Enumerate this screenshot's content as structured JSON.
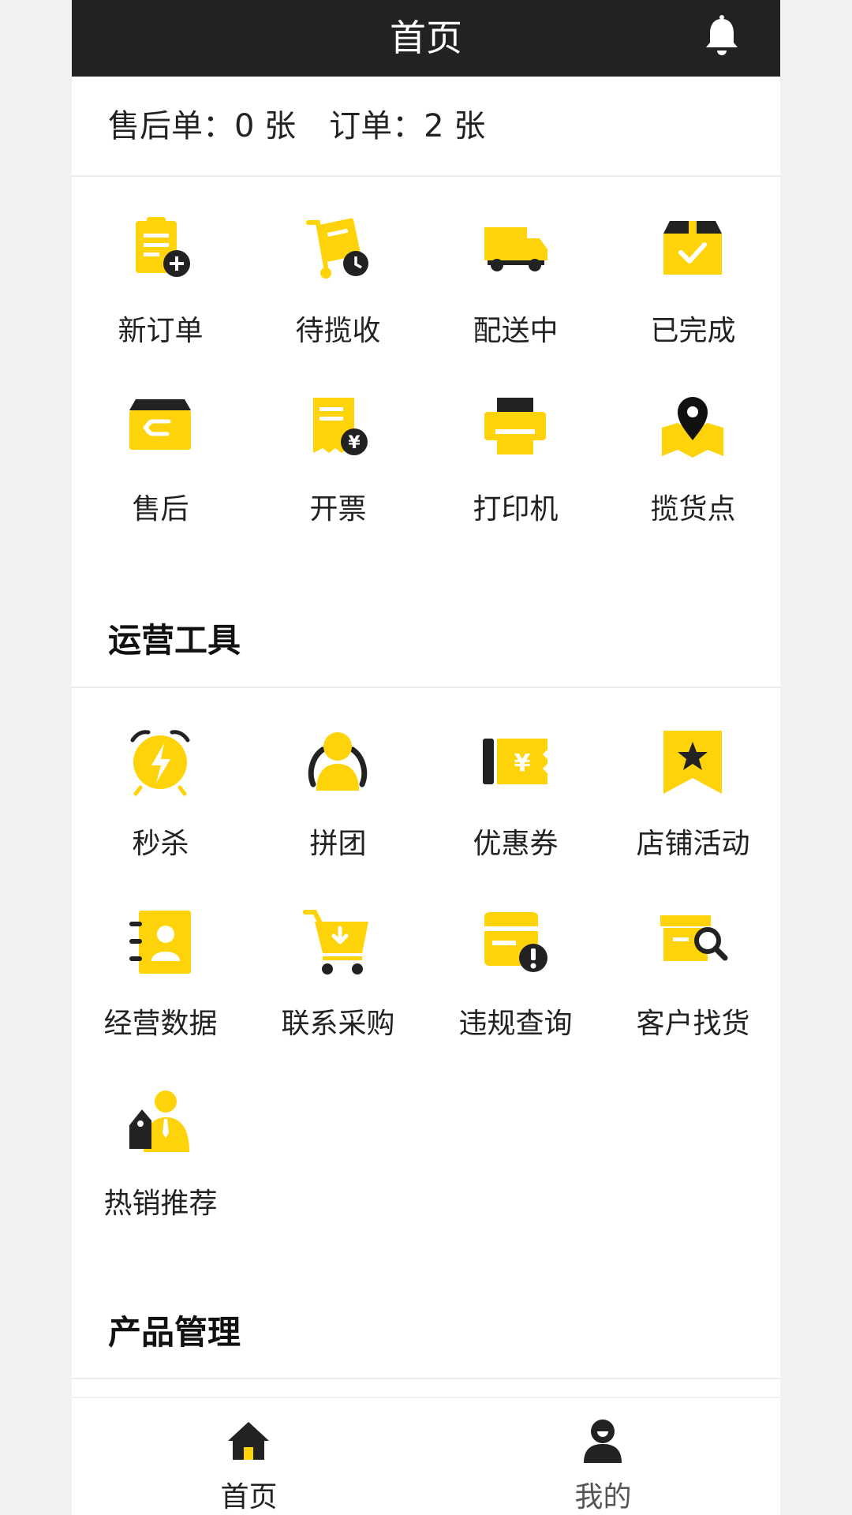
{
  "header": {
    "title": "首页",
    "bell_icon": "bell-icon"
  },
  "summary": {
    "after_sales_label": "售后单：",
    "after_sales_count": "0 张",
    "orders_label": "订单：",
    "orders_count": "2 张"
  },
  "order_grid": [
    {
      "label": "新订单",
      "icon": "new-order-icon"
    },
    {
      "label": "待揽收",
      "icon": "pending-pickup-icon"
    },
    {
      "label": "配送中",
      "icon": "delivery-truck-icon"
    },
    {
      "label": "已完成",
      "icon": "completed-box-icon"
    },
    {
      "label": "售后",
      "icon": "after-sales-box-icon"
    },
    {
      "label": "开票",
      "icon": "invoice-icon"
    },
    {
      "label": "打印机",
      "icon": "printer-icon"
    },
    {
      "label": "揽货点",
      "icon": "pickup-location-icon"
    }
  ],
  "operations": {
    "title": "运营工具",
    "items": [
      {
        "label": "秒杀",
        "icon": "flash-sale-clock-icon"
      },
      {
        "label": "拼团",
        "icon": "group-buy-icon"
      },
      {
        "label": "优惠券",
        "icon": "coupon-icon"
      },
      {
        "label": "店铺活动",
        "icon": "store-activity-icon"
      },
      {
        "label": "经营数据",
        "icon": "business-data-icon"
      },
      {
        "label": "联系采购",
        "icon": "purchase-cart-icon"
      },
      {
        "label": "违规查询",
        "icon": "violation-query-icon"
      },
      {
        "label": "客户找货",
        "icon": "customer-search-icon"
      },
      {
        "label": "热销推荐",
        "icon": "hot-sale-recommend-icon"
      }
    ]
  },
  "products": {
    "title": "产品管理"
  },
  "tabbar": {
    "items": [
      {
        "label": "首页",
        "icon": "home-icon",
        "active": true
      },
      {
        "label": "我的",
        "icon": "profile-icon",
        "active": false
      }
    ]
  },
  "colors": {
    "accent": "#FFD30A",
    "dark": "#222222",
    "inactive_tab": "#555555"
  }
}
